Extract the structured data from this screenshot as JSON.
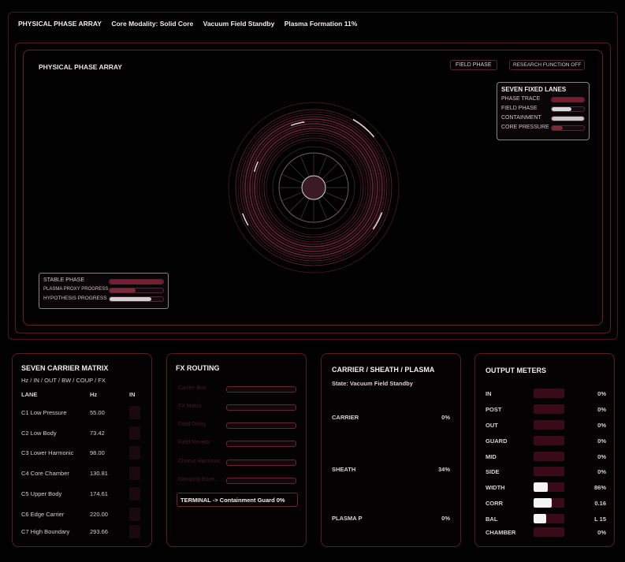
{
  "header": {
    "title": "PHYSICAL PHASE ARRAY",
    "modality": "Core Modality: Solid Core",
    "standby": "Vacuum Field Standby",
    "plasma": "Plasma Formation 11%"
  },
  "stage": {
    "title": "PHYSICAL PHASE ARRAY",
    "field_phase_button": "FIELD PHASE",
    "research_button": "RESEARCH FUNCTION OFF"
  },
  "lanes": {
    "title": "SEVEN FIXED LANES",
    "items": [
      {
        "label": "PHASE TRACE",
        "level": 1.0,
        "color": "#7c1a2e"
      },
      {
        "label": "FIELD PHASE",
        "level": 0.62,
        "color": "#d8d8d8"
      },
      {
        "label": "CONTAINMENT",
        "level": 1.0,
        "color": "#c9c9c9"
      },
      {
        "label": "CORE PRESSURE",
        "level": 0.33,
        "color": "#7c2a38"
      }
    ]
  },
  "stable": {
    "items": [
      {
        "label": "STABLE PHASE",
        "level": 1.0,
        "color": "#7c1a2e"
      },
      {
        "label": "PLASMA PROXY PROGRESS",
        "level": 0.48,
        "color": "#7c2a38"
      },
      {
        "label": "HYPOTHESIS PROGRESS",
        "level": 0.78,
        "color": "#d0d0d0"
      }
    ]
  },
  "carrier_matrix": {
    "title": "SEVEN CARRIER MATRIX",
    "subtitle": "Hz / IN / OUT / BW / COUP / FX",
    "headers": {
      "lane": "LANE",
      "hz": "Hz",
      "in": "IN"
    },
    "rows": [
      {
        "lane": "C1 Low Pressure",
        "hz": "55.00"
      },
      {
        "lane": "C2 Low Body",
        "hz": "73.42"
      },
      {
        "lane": "C3 Lower Harmonic",
        "hz": "98.00"
      },
      {
        "lane": "C4 Core Chamber",
        "hz": "130.81"
      },
      {
        "lane": "C5 Upper Body",
        "hz": "174.61"
      },
      {
        "lane": "C6 Edge Carrier",
        "hz": "220.00"
      },
      {
        "lane": "C7 High Boundary",
        "hz": "293.66"
      }
    ]
  },
  "fx": {
    "title": "FX ROUTING",
    "rows": [
      "Carrier Bus",
      "FX Matrix",
      "Field Delay",
      "Field Reverb",
      "Chorus Harmonic",
      "Damping Enve..."
    ],
    "terminal": "TERMINAL -> Containment Guard  0%"
  },
  "csp": {
    "title": "CARRIER / SHEATH / PLASMA",
    "state": "State: Vacuum Field Standby",
    "rows": [
      {
        "label": "CARRIER",
        "value": "0%"
      },
      {
        "label": "SHEATH",
        "value": "34%"
      },
      {
        "label": "PLASMA P",
        "value": "0%"
      }
    ]
  },
  "meters": {
    "title": "OUTPUT METERS",
    "rows": [
      {
        "label": "IN",
        "value": "0%",
        "level": 0
      },
      {
        "label": "POST",
        "value": "0%",
        "level": 0
      },
      {
        "label": "OUT",
        "value": "0%",
        "level": 0
      },
      {
        "label": "GUARD",
        "value": "0%",
        "level": 0
      },
      {
        "label": "MID",
        "value": "0%",
        "level": 0
      },
      {
        "label": "SIDE",
        "value": "0%",
        "level": 0
      },
      {
        "label": "WIDTH",
        "value": "86%",
        "level": 0.45
      },
      {
        "label": "CORR",
        "value": "0.16",
        "level": 0.58
      },
      {
        "label": "BAL",
        "value": "L 15",
        "level": 0.42
      },
      {
        "label": "CHAMBER",
        "value": "0%",
        "level": 0
      }
    ]
  }
}
